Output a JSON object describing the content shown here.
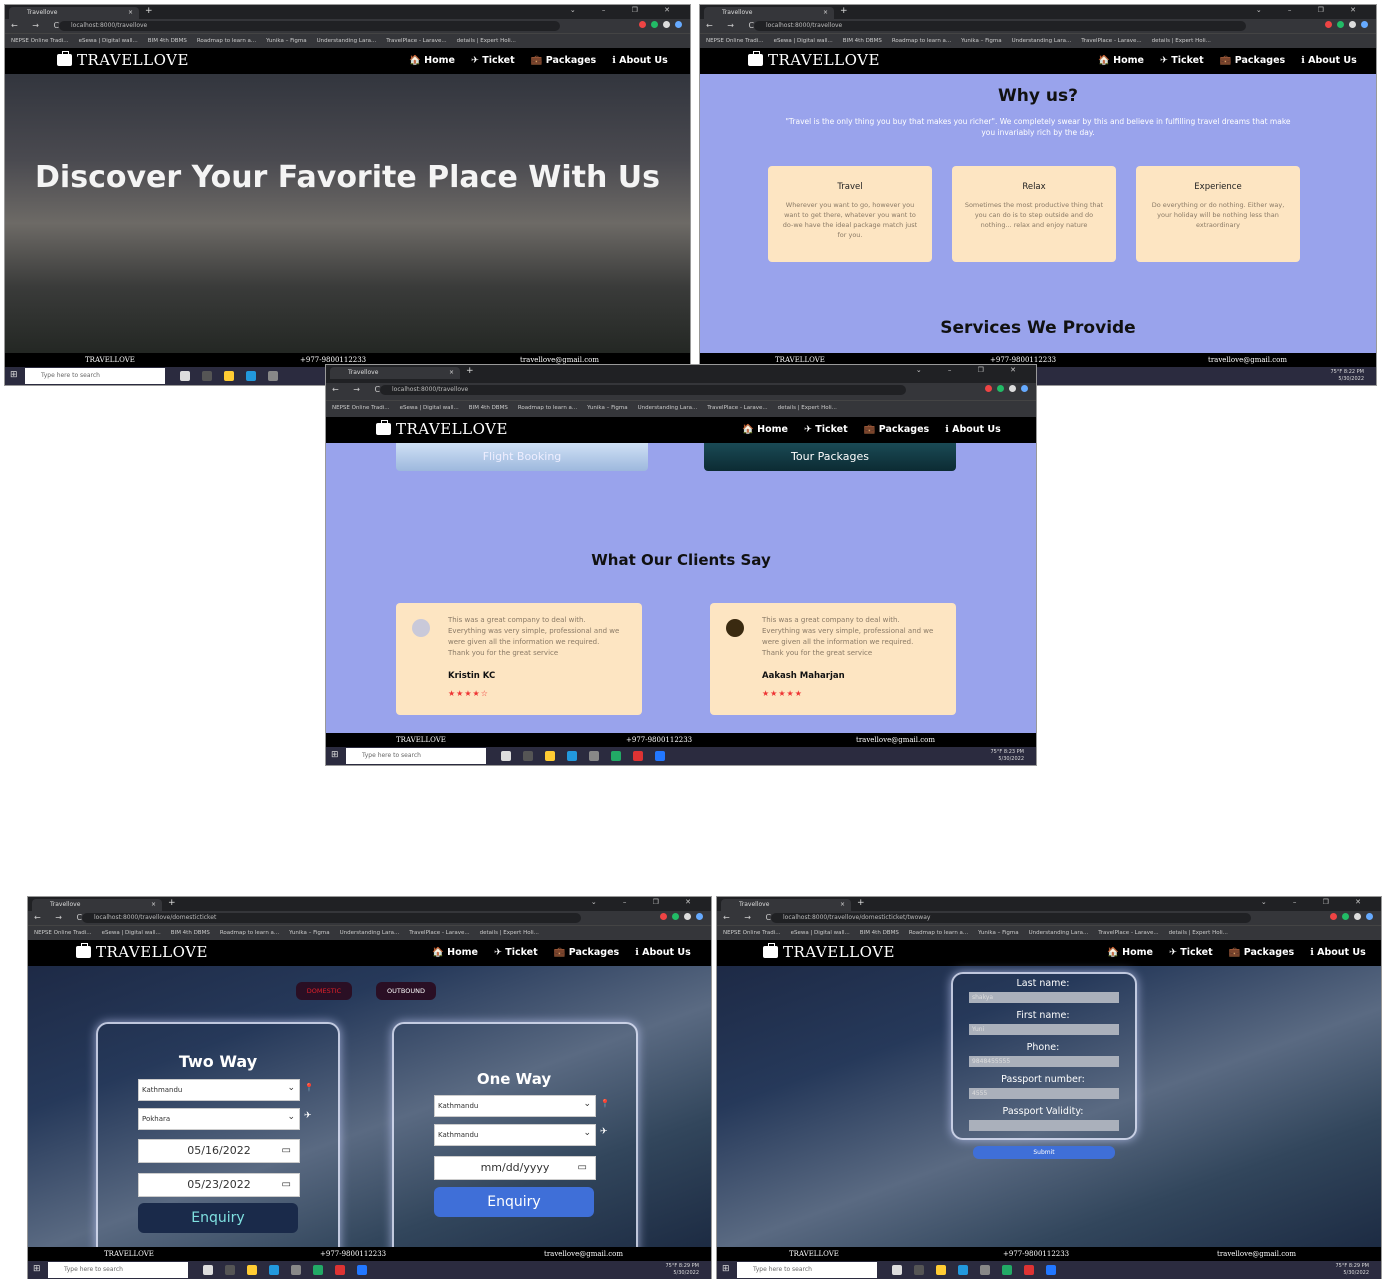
{
  "browser": {
    "tab_title": "Travellove",
    "new_tab": "+",
    "window_controls": "⌄ – ❐ ✕",
    "nav": "← → C",
    "urls": {
      "home": "localhost:8000/travellove",
      "domestic": "localhost:8000/travellove/domesticticket",
      "twoway": "localhost:8000/travellove/domesticticket/twoway"
    },
    "bookmarks": [
      "NEPSE Online Tradi...",
      "eSewa | Digital wall...",
      "BIM 4th DBMS",
      "Roadmap to learn a...",
      "Yunika – Figma",
      "Understanding Lara...",
      "TravelPlace - Larave...",
      "details | Expert Holi..."
    ]
  },
  "site": {
    "logo": "TRAVELLOVE",
    "menu": [
      "🏠 Home",
      "✈ Ticket",
      "💼 Packages",
      "ℹ About Us"
    ],
    "footer": {
      "brand": "TRAVELLOVE",
      "phone": "+977-9800112233",
      "email": "travellove@gmail.com"
    }
  },
  "taskbar": {
    "search": "Type here to search",
    "weather": "75°F",
    "times": [
      "8:22 PM",
      "8:23 PM",
      "8:29 PM"
    ],
    "date": "5/30/2022"
  },
  "hero": {
    "title": "Discover Your Favorite Place With Us"
  },
  "why": {
    "title": "Why us?",
    "quote": "\"Travel is the only thing you buy that makes you richer\". We completely swear by this and believe in fulfilling travel dreams that make you invariably rich by the day.",
    "cards": [
      {
        "title": "Travel",
        "text": "Wherever you want to go, however you want to get there, whatever you want to do-we have the ideal package match just for you."
      },
      {
        "title": "Relax",
        "text": "Sometimes the most productive thing that you can do is to step outside and do nothing... relax and enjoy nature"
      },
      {
        "title": "Experience",
        "text": "Do everything or do nothing. Either way, your holiday will be nothing less than extraordinary"
      }
    ],
    "services_title": "Services We Provide"
  },
  "clients": {
    "services": [
      "Flight Booking",
      "Tour Packages"
    ],
    "title": "What Our Clients Say",
    "reviews": [
      {
        "text": "This was a great company to deal with. Everything was very simple, professional and we were given all the information we required. Thank you for the great service",
        "name": "Kristin KC",
        "stars": "★★★★☆"
      },
      {
        "text": "This was a great company to deal with. Everything was very simple, professional and we were given all the information we required. Thank you for the great service",
        "name": "Aakash Maharjan",
        "stars": "★★★★★"
      }
    ]
  },
  "ticket": {
    "tabs": [
      "DOMESTIC",
      "OUTBOUND"
    ],
    "twoway": {
      "title": "Two Way",
      "from": "Kathmandu",
      "to": "Pokhara",
      "depart": "05/16/2022",
      "return": "05/23/2022",
      "button": "Enquiry"
    },
    "oneway": {
      "title": "One Way",
      "from": "Kathmandu",
      "to": "Kathmandu",
      "date": "mm/dd/yyyy",
      "button": "Enquiry"
    }
  },
  "form": {
    "fields": [
      {
        "label": "Last name:",
        "value": "shakya"
      },
      {
        "label": "First name:",
        "value": "Yuni"
      },
      {
        "label": "Phone:",
        "value": "9848455555"
      },
      {
        "label": "Passport number:",
        "value": "4555"
      },
      {
        "label": "Passport Validity:",
        "value": ""
      }
    ],
    "submit": "Submit"
  },
  "colors": {
    "accent_blue": "#99a3ec",
    "card": "#fde5c2",
    "button": "#3f6fd8",
    "domestic_red": "#e0202a"
  }
}
